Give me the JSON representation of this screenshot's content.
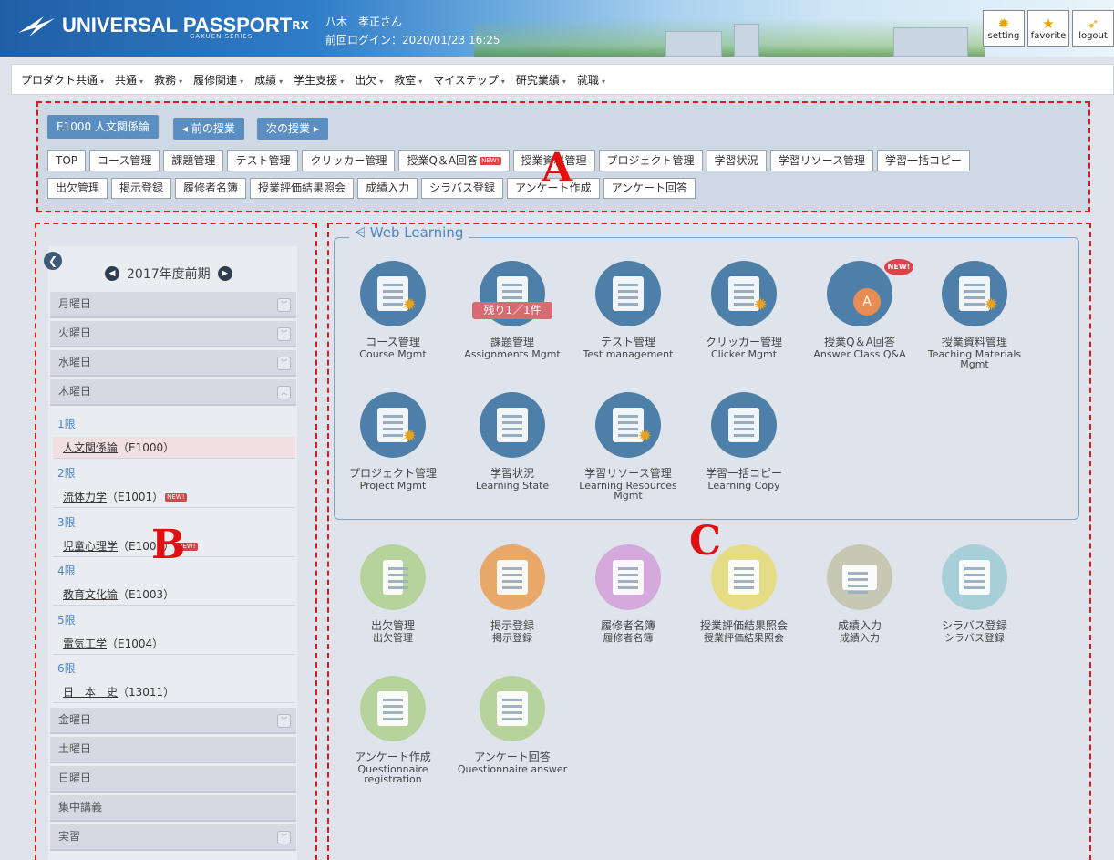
{
  "header": {
    "logo": "UNIVERSAL PASSPORT",
    "logo_sup": "RX",
    "logo_sub": "GAKUEN SERIES",
    "user_name": "八木　孝正さん",
    "last_login": "前回ログイン：2020/01/23 16:25",
    "buttons": [
      {
        "label": "setting",
        "icon": "gear-icon"
      },
      {
        "label": "favorite",
        "icon": "star-icon"
      },
      {
        "label": "logout",
        "icon": "runner-icon"
      }
    ]
  },
  "nav": {
    "items": [
      "プロダクト共通",
      "共通",
      "教務",
      "履修関連",
      "成績",
      "学生支援",
      "出欠",
      "教室",
      "マイステップ",
      "研究業績",
      "就職"
    ]
  },
  "class_bar": {
    "course_button": "E1000  人文関係論",
    "prev_button": "◂ 前の授業",
    "next_button": "次の授業 ▸",
    "tabs_row1": [
      "TOP",
      "コース管理",
      "課題管理",
      "テスト管理",
      "クリッカー管理",
      "授業Q＆A回答",
      "授業資料管理",
      "プロジェクト管理",
      "学習状況",
      "学習リソース管理",
      "学習一括コピー"
    ],
    "tabs_row2": [
      "出欠管理",
      "掲示登録",
      "履修者名簿",
      "授業評価結果照会",
      "成績入力",
      "シラバス登録",
      "アンケート作成",
      "アンケート回答"
    ],
    "new_badge": "NEW!"
  },
  "sidebar": {
    "term": "2017年度前期",
    "days_top": [
      {
        "label": "月曜日",
        "toggle": "v"
      },
      {
        "label": "火曜日",
        "toggle": "v"
      },
      {
        "label": "水曜日",
        "toggle": "v"
      },
      {
        "label": "木曜日",
        "toggle": "^"
      }
    ],
    "periods": [
      {
        "label": "1限",
        "course": "人文関係論",
        "code": "（E1000）",
        "new": ""
      },
      {
        "label": "2限",
        "course": "流体力学",
        "code": "（E1001）",
        "new": "NEW!"
      },
      {
        "label": "3限",
        "course": "児童心理学",
        "code": "（E1002）",
        "new": "NEW!"
      },
      {
        "label": "4限",
        "course": "教育文化論",
        "code": "（E1003）",
        "new": ""
      },
      {
        "label": "5限",
        "course": "電気工学",
        "code": "（E1004）",
        "new": ""
      },
      {
        "label": "6限",
        "course": "日　本　史",
        "code": "（13011）",
        "new": ""
      }
    ],
    "days_bottom": [
      {
        "label": "金曜日",
        "toggle": "v"
      },
      {
        "label": "土曜日",
        "toggle": ""
      },
      {
        "label": "日曜日",
        "toggle": ""
      },
      {
        "label": "集中講義",
        "toggle": ""
      },
      {
        "label": "実習",
        "toggle": "v"
      }
    ]
  },
  "web_learning": {
    "title": "Web Learning",
    "remaining": "残り1／1件",
    "new_label": "NEW!",
    "tiles": [
      {
        "jp": "コース管理",
        "en": "Course Mgmt",
        "color": "#4d7fa8"
      },
      {
        "jp": "課題管理",
        "en": "Assignments Mgmt",
        "color": "#4d7fa8"
      },
      {
        "jp": "テスト管理",
        "en": "Test management",
        "color": "#4d7fa8"
      },
      {
        "jp": "クリッカー管理",
        "en": "Clicker Mgmt",
        "color": "#4d7fa8"
      },
      {
        "jp": "授業Q＆A回答",
        "en": "Answer Class Q&A",
        "color": "#4d7fa8"
      },
      {
        "jp": "授業資料管理",
        "en": "Teaching Materials Mgmt",
        "color": "#4d7fa8"
      },
      {
        "jp": "プロジェクト管理",
        "en": "Project Mgmt",
        "color": "#4d7fa8"
      },
      {
        "jp": "学習状況",
        "en": "Learning State",
        "color": "#4d7fa8"
      },
      {
        "jp": "学習リソース管理",
        "en": "Learning Resources Mgmt",
        "color": "#4d7fa8"
      },
      {
        "jp": "学習一括コピー",
        "en": "Learning Copy",
        "color": "#4d7fa8"
      }
    ]
  },
  "other_tiles": [
    {
      "jp": "出欠管理",
      "en": "出欠管理",
      "color": "#b5d39a"
    },
    {
      "jp": "掲示登録",
      "en": "掲示登録",
      "color": "#e8a86a"
    },
    {
      "jp": "履修者名簿",
      "en": "履修者名簿",
      "color": "#d4a9dc"
    },
    {
      "jp": "授業評価結果照会",
      "en": "授業評価結果照会",
      "color": "#e6dc86"
    },
    {
      "jp": "成績入力",
      "en": "成績入力",
      "color": "#c6c8b4"
    },
    {
      "jp": "シラバス登録",
      "en": "シラバス登録",
      "color": "#a6cfd8"
    },
    {
      "jp": "アンケート作成",
      "en": "Questionnaire registration",
      "color": "#b5d39a"
    },
    {
      "jp": "アンケート回答",
      "en": "Questionnaire answer",
      "color": "#b5d39a"
    }
  ],
  "region_labels": {
    "a": "A",
    "b": "B",
    "c": "C"
  }
}
